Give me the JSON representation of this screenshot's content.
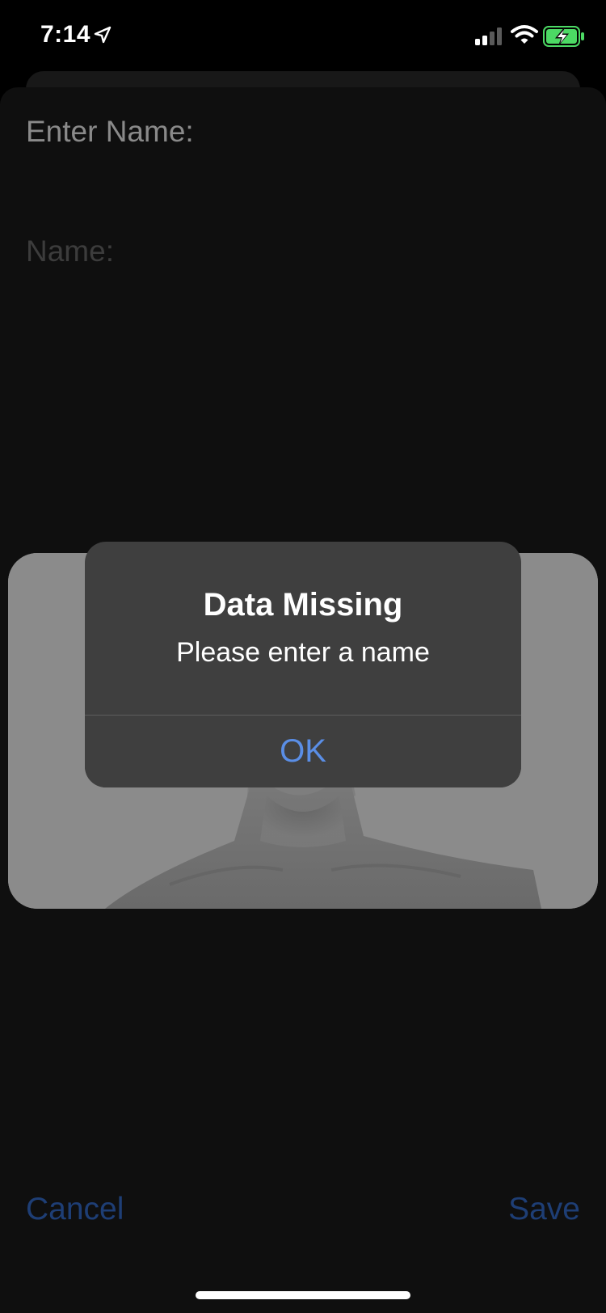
{
  "status_bar": {
    "time": "7:14",
    "icons": [
      "location-arrow-icon",
      "cellular-signal-icon",
      "wifi-icon",
      "battery-charging-icon"
    ],
    "battery_color": "#4cd964"
  },
  "form": {
    "heading": "Enter Name:",
    "name_label": "Name:"
  },
  "photo": {
    "description_icon": "portrait-photo"
  },
  "alert": {
    "title": "Data Missing",
    "message": "Please enter a name",
    "ok_label": "OK"
  },
  "footer": {
    "cancel_label": "Cancel",
    "save_label": "Save"
  },
  "colors": {
    "accent_link": "#5a8ee6",
    "dimmed_button": "#1e3e75",
    "alert_bg": "#3f3f3f",
    "sheet_bg": "#0f0f0f"
  }
}
